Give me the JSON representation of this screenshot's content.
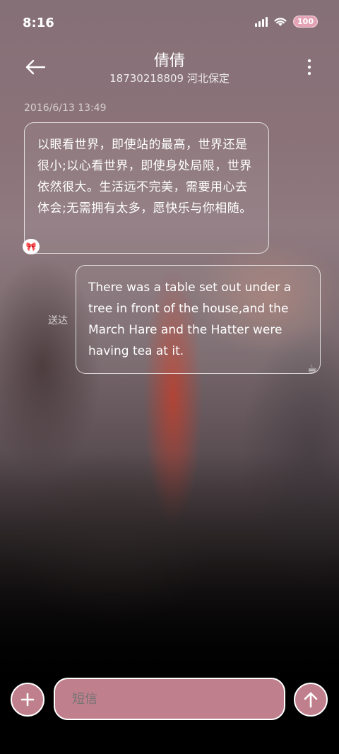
{
  "status": {
    "time": "8:16",
    "battery": "100"
  },
  "header": {
    "contact_name": "倩倩",
    "contact_sub": "18730218809 河北保定"
  },
  "conversation": {
    "timestamp": "2016/6/13 13:49",
    "incoming_message": "以眼看世界，即使站的最高，世界还是很小;以心看世界，即使身处局限，世界依然很大。生活远不完美，需要用心去体会;无需拥有太多，愿快乐与你相随。",
    "outgoing_message": "There was a table set out under a tree in front of the house,and the March Hare and the Hatter were having tea at it.",
    "delivered_label": "送达"
  },
  "composer": {
    "placeholder": "短信"
  },
  "icons": {
    "back": "arrow-left-icon",
    "more": "more-vertical-icon",
    "add": "plus-icon",
    "send": "arrow-up-icon",
    "incoming_sticker": "bow-icon",
    "outgoing_sticker": "coffee-cup-icon"
  },
  "colors": {
    "accent": "#c07f8c",
    "battery": "#e4a3b4"
  }
}
